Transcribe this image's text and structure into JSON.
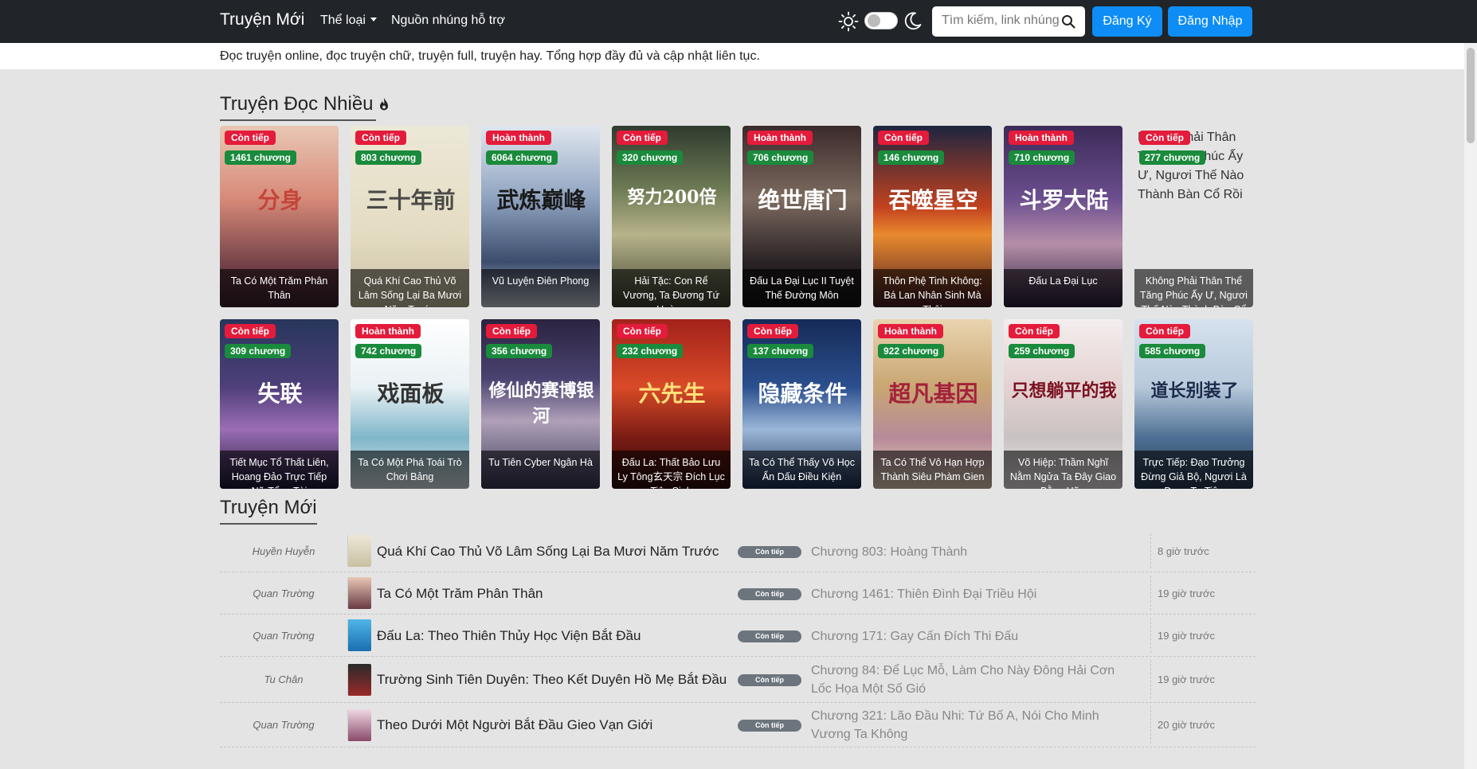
{
  "navbar": {
    "brand": "Truyện Mới",
    "genre_menu": "Thể loại",
    "sources_link": "Nguồn nhúng hỗ trợ",
    "search_placeholder": "Tìm kiếm, link nhúng",
    "register": "Đăng Ký",
    "login": "Đăng Nhập",
    "theme_toggle_on": false,
    "icons": [
      "sun-icon",
      "moon-icon",
      "search-icon"
    ]
  },
  "tagline": "Đọc truyện online, đọc truyện chữ, truyện full, truyện hay. Tổng hợp đầy đủ và cập nhật liên tục.",
  "popular": {
    "title": "Truyện Đọc Nhiều",
    "icon": "fire-icon",
    "cards": [
      {
        "status": "Còn tiếp",
        "chapters": "1461 chương",
        "title": "Ta Có Một Trăm Phân Thân",
        "deco": "分身"
      },
      {
        "status": "Còn tiếp",
        "chapters": "803 chương",
        "title": "Quá Khí Cao Thủ Võ Lâm Sống Lại Ba Mươi Năm Trước",
        "deco": "三十年前"
      },
      {
        "status": "Hoàn thành",
        "chapters": "6064 chương",
        "title": "Vũ Luyện Điên Phong",
        "deco": "武炼巅峰"
      },
      {
        "status": "Còn tiếp",
        "chapters": "320 chương",
        "title": "Hải Tặc: Con Rể Vương, Ta Đương Tứ Hoàng",
        "deco": "努力200倍"
      },
      {
        "status": "Hoàn thành",
        "chapters": "706 chương",
        "title": "Đấu La Đại Lục II Tuyệt Thế Đường Môn",
        "deco": "绝世唐门"
      },
      {
        "status": "Còn tiếp",
        "chapters": "146 chương",
        "title": "Thôn Phệ Tinh Không: Bá Lan Nhân Sinh Mà Thôi",
        "deco": "吞噬星空"
      },
      {
        "status": "Hoàn thành",
        "chapters": "710 chương",
        "title": "Đấu La Đại Lục",
        "deco": "斗罗大陆"
      },
      {
        "status": "Còn tiếp",
        "chapters": "277 chương",
        "title": "Không Phải Thân Thể Tăng Phúc Ấy Ư, Ngươi Thế Nào Thành Bàn Cổ Rồi",
        "alt": "Không Phải Thân Thể Tăng Phúc Ấy Ư, Ngươi Thế Nào Thành Bàn Cổ Rồi"
      },
      {
        "status": "Còn tiếp",
        "chapters": "309 chương",
        "title": "Tiết Mục Tổ Thất Liên, Hoang Đảo Trực Tiếp Nữ Tổng Tài",
        "deco": "失联"
      },
      {
        "status": "Hoàn thành",
        "chapters": "742 chương",
        "title": "Ta Có Một Phá Toái Trò Chơi Bảng",
        "deco": "戏面板"
      },
      {
        "status": "Còn tiếp",
        "chapters": "356 chương",
        "title": "Tu Tiên Cyber Ngân Hà",
        "deco": "修仙的赛博银河"
      },
      {
        "status": "Còn tiếp",
        "chapters": "232 chương",
        "title": "Đấu La: Thất Bảo Lưu Ly Tông玄天宗 Đích Lục Tiên Sinh",
        "deco": "六先生"
      },
      {
        "status": "Còn tiếp",
        "chapters": "137 chương",
        "title": "Ta Có Thể Thấy Võ Học Ẩn Dấu Điều Kiện",
        "deco": "隐藏条件"
      },
      {
        "status": "Hoàn thành",
        "chapters": "922 chương",
        "title": "Ta Có Thể Vô Hạn Hợp Thành Siêu Phàm Gien",
        "deco": "超凡基因"
      },
      {
        "status": "Còn tiếp",
        "chapters": "259 chương",
        "title": "Võ Hiệp: Thầm Nghĩ Nằm Ngửa Ta Đây Giao Bằng Hữu",
        "deco": "只想躺平的我"
      },
      {
        "status": "Còn tiếp",
        "chapters": "585 chương",
        "title": "Trực Tiếp: Đạo Trưởng Đừng Giả Bộ, Ngươi Là Đang Tu Tiên",
        "deco": "道长别装了"
      }
    ]
  },
  "latest": {
    "title": "Truyện Mới",
    "rows": [
      {
        "genre": "Huyền Huyễn",
        "title": "Quá Khí Cao Thủ Võ Lâm Sống Lại Ba Mươi Năm Trước",
        "status": "Còn tiếp",
        "chapter": "Chương 803: Hoàng Thành",
        "time": "8 giờ trước"
      },
      {
        "genre": "Quan Trường",
        "title": "Ta Có Một Trăm Phân Thân",
        "status": "Còn tiếp",
        "chapter": "Chương 1461: Thiên Đình Đại Triều Hội",
        "time": "19 giờ trước"
      },
      {
        "genre": "Quan Trường",
        "title": "Đấu La: Theo Thiên Thủy Học Viện Bắt Đầu",
        "status": "Còn tiếp",
        "chapter": "Chương 171: Gay Cấn Đích Thi Đấu",
        "time": "19 giờ trước"
      },
      {
        "genre": "Tu Chân",
        "title": "Trường Sinh Tiên Duyên: Theo Kết Duyên Hồ Mẹ Bắt Đầu",
        "status": "Còn tiếp",
        "chapter": "Chương 84: Để Lục Mỗ, Làm Cho Này Đông Hải Cơn Lốc Họa Một Số Gió",
        "time": "19 giờ trước"
      },
      {
        "genre": "Quan Trường",
        "title": "Theo Dưới Một Người Bắt Đầu Gieo Vạn Giới",
        "status": "Còn tiếp",
        "chapter": "Chương 321: Lão Đầu Nhi: Tứ Bố A, Nói Cho Minh Vương Ta Không",
        "time": "20 giờ trước"
      }
    ]
  },
  "colors": {
    "navbar": "#212529",
    "primary_button": "#0d8df5",
    "status_badge": "#e41b3b",
    "chapter_badge": "#1a8a3c",
    "list_status_pill": "#6c757d"
  }
}
